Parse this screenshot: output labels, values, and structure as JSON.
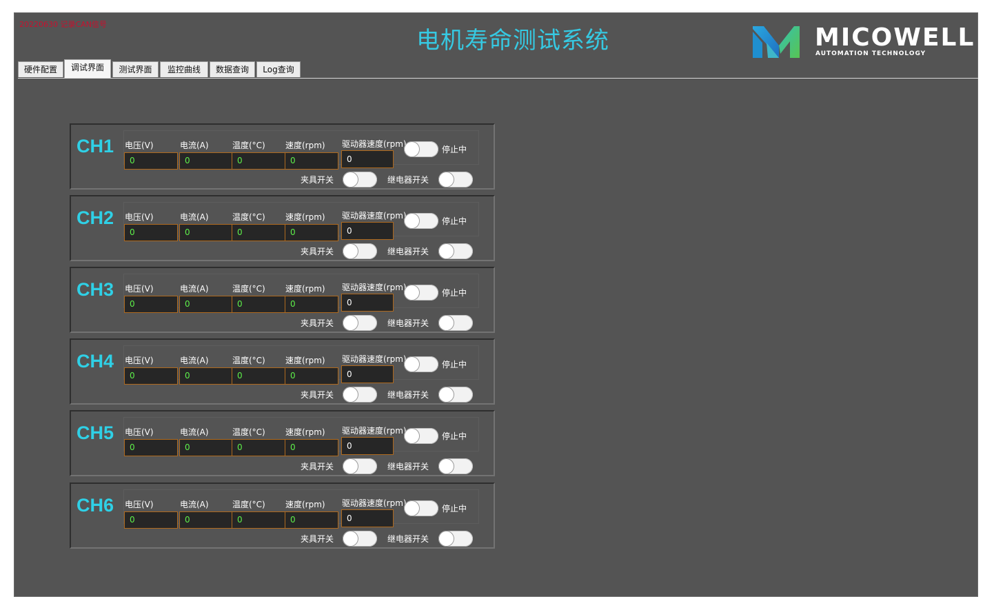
{
  "header": {
    "note": "20220630 记录CAN信号",
    "title": "电机寿命测试系统",
    "logo_name": "MICOWELL",
    "logo_tagline": "AUTOMATION TECHNOLOGY"
  },
  "tabs": [
    {
      "label": "硬件配置"
    },
    {
      "label": "调试界面"
    },
    {
      "label": "测试界面"
    },
    {
      "label": "监控曲线"
    },
    {
      "label": "数据查询"
    },
    {
      "label": "Log查询"
    }
  ],
  "active_tab": "调试界面",
  "field_labels": {
    "voltage": "电压(V)",
    "current": "电流(A)",
    "temperature": "温度(°C)",
    "speed": "速度(rpm)",
    "driver_speed": "驱动器速度(rpm)",
    "status": "停止中",
    "clamp_switch": "夹具开关",
    "relay_switch": "继电器开关"
  },
  "channels": [
    {
      "name": "CH1",
      "voltage": "0",
      "current": "0",
      "temperature": "0",
      "speed": "0",
      "driver_speed": "0"
    },
    {
      "name": "CH2",
      "voltage": "0",
      "current": "0",
      "temperature": "0",
      "speed": "0",
      "driver_speed": "0"
    },
    {
      "name": "CH3",
      "voltage": "0",
      "current": "0",
      "temperature": "0",
      "speed": "0",
      "driver_speed": "0"
    },
    {
      "name": "CH4",
      "voltage": "0",
      "current": "0",
      "temperature": "0",
      "speed": "0",
      "driver_speed": "0"
    },
    {
      "name": "CH5",
      "voltage": "0",
      "current": "0",
      "temperature": "0",
      "speed": "0",
      "driver_speed": "0"
    },
    {
      "name": "CH6",
      "voltage": "0",
      "current": "0",
      "temperature": "0",
      "speed": "0",
      "driver_speed": "0"
    }
  ],
  "colors": {
    "panel_bg": "#545454",
    "title": "#36c9e2",
    "channel_label": "#2fd0e6",
    "field_border": "#b06a1e",
    "field_value": "#5ef04a",
    "note": "#c8102e"
  }
}
